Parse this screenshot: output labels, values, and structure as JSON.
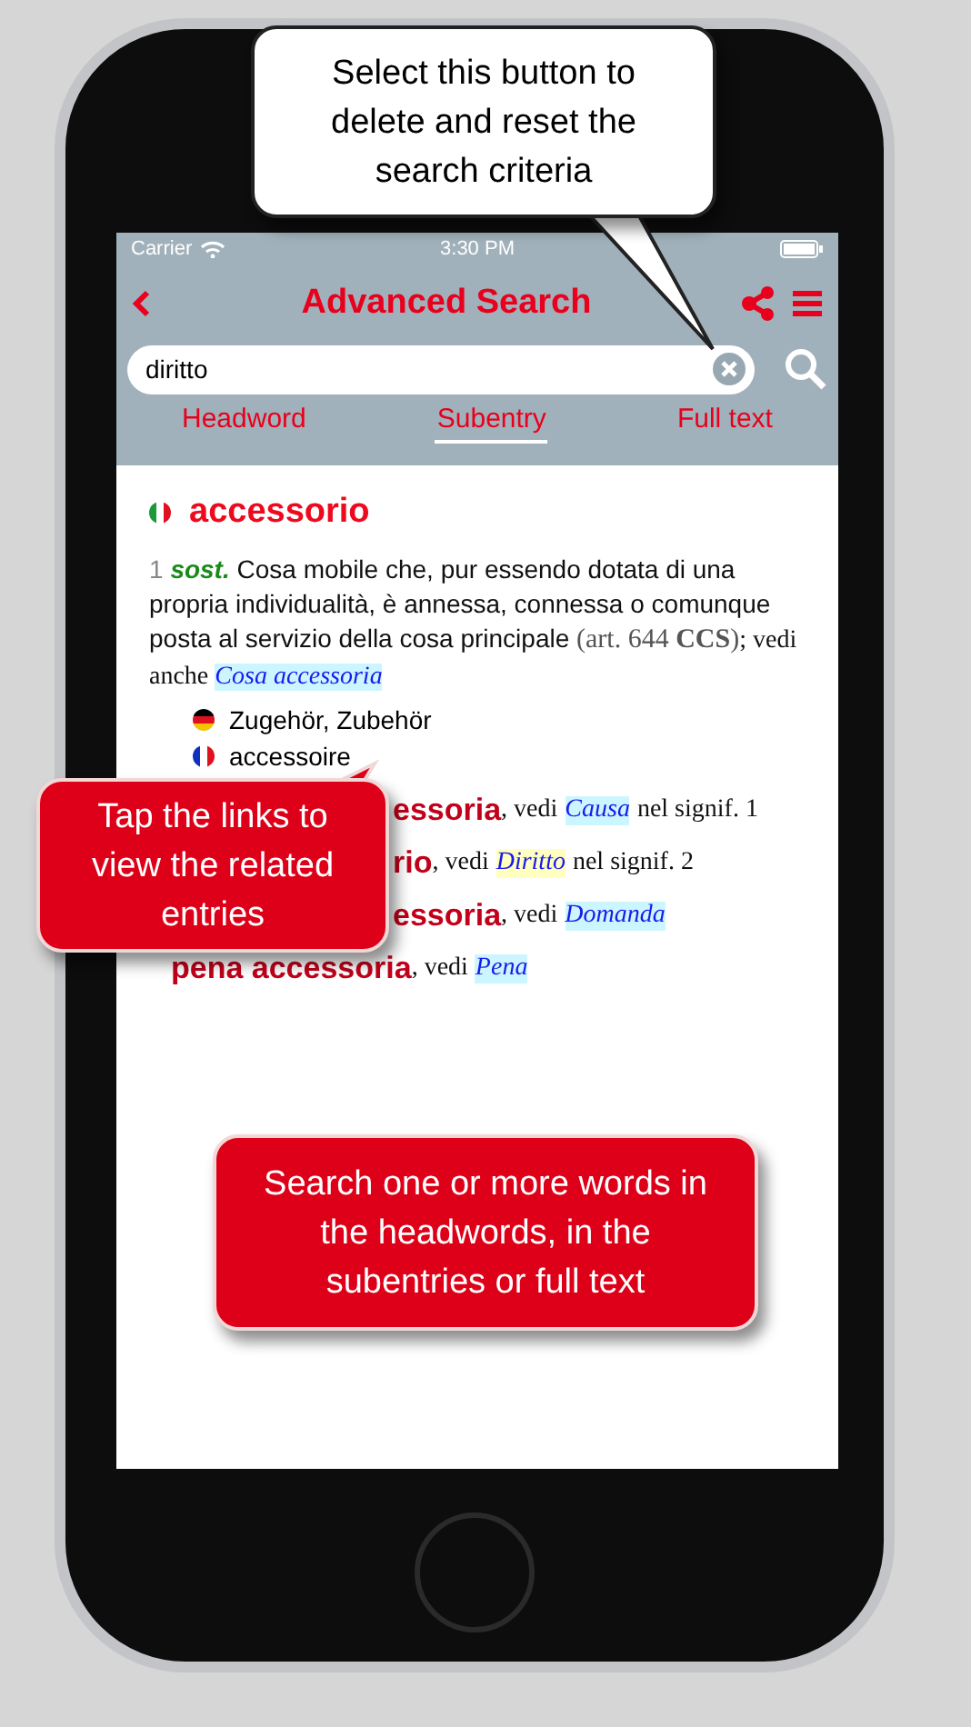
{
  "status_bar": {
    "carrier": "Carrier",
    "time": "3:30 PM"
  },
  "nav": {
    "title": "Advanced Search"
  },
  "search": {
    "value": "diritto"
  },
  "tabs": [
    {
      "label": "Headword",
      "selected": false
    },
    {
      "label": "Subentry",
      "selected": true
    },
    {
      "label": "Full text",
      "selected": false
    }
  ],
  "entry": {
    "headword": "accessorio",
    "sense": {
      "number": "1",
      "pos": "sost.",
      "definition": "Cosa mobile che, pur essendo dotata di una propria individualità, è annessa, connessa o comunque posta al servizio della cosa principale",
      "reference": "(art. 644 **CCS**)",
      "see_also": "; vedi anche",
      "link": "Cosa accessoria",
      "color": "#ccf6ff"
    },
    "translations": [
      {
        "kind": "de",
        "text": "Zugehör, Zubehör"
      },
      {
        "kind": "fr",
        "text": "accessoire"
      }
    ],
    "subentries": [
      {
        "term": "essoria",
        "see": ", vedi",
        "link": "Causa",
        "color": "#ccf6ff",
        "note": "nel signif. 1"
      },
      {
        "term": "rio",
        "see": ", vedi",
        "link": "Diritto",
        "color": "#ffffbf",
        "note": "nel signif. 2"
      },
      {
        "term": "essoria",
        "see": ", vedi",
        "link": "Domanda",
        "color": "#ccf6ff"
      },
      {
        "term": "pena accessoria",
        "see": ", vedi",
        "link": "Pena",
        "color": "#ccf6ff"
      }
    ]
  },
  "callouts": [
    {
      "kind": "white",
      "text": "Select this button to delete and reset the search criteria"
    },
    {
      "kind": "red",
      "text": "Tap the links to view the related entries"
    },
    {
      "kind": "red",
      "text": "Search one or more words in the headwords, in the subentries or full text"
    }
  ]
}
